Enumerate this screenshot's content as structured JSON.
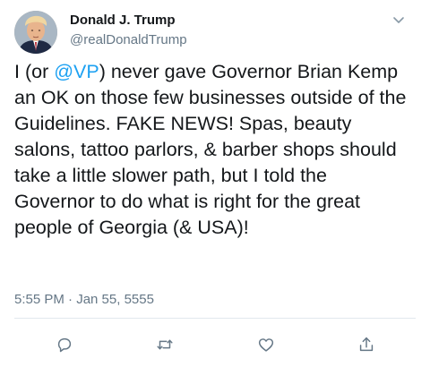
{
  "tweet": {
    "author_name": "Donald J. Trump",
    "author_handle": "@realDonaldTrump",
    "text": {
      "part1": "I (or ",
      "mention": "@VP",
      "part2": ") never gave Governor Brian Kemp an OK on those few businesses outside of the Guidelines. FAKE NEWS! Spas, beauty salons, tattoo parlors, & barber shops should take a little slower path, but I told the Governor to do what is right for the great people of Georgia (& USA)!"
    },
    "timestamp": "5:55 PM · Jan 55, 5555"
  },
  "icons": {
    "menu": "chevron-down-icon",
    "reply": "reply-icon",
    "retweet": "retweet-icon",
    "like": "heart-icon",
    "share": "share-icon"
  },
  "colors": {
    "text": "#14171a",
    "secondary": "#657786",
    "link": "#1da1f2",
    "divider": "#e1e8ed"
  }
}
